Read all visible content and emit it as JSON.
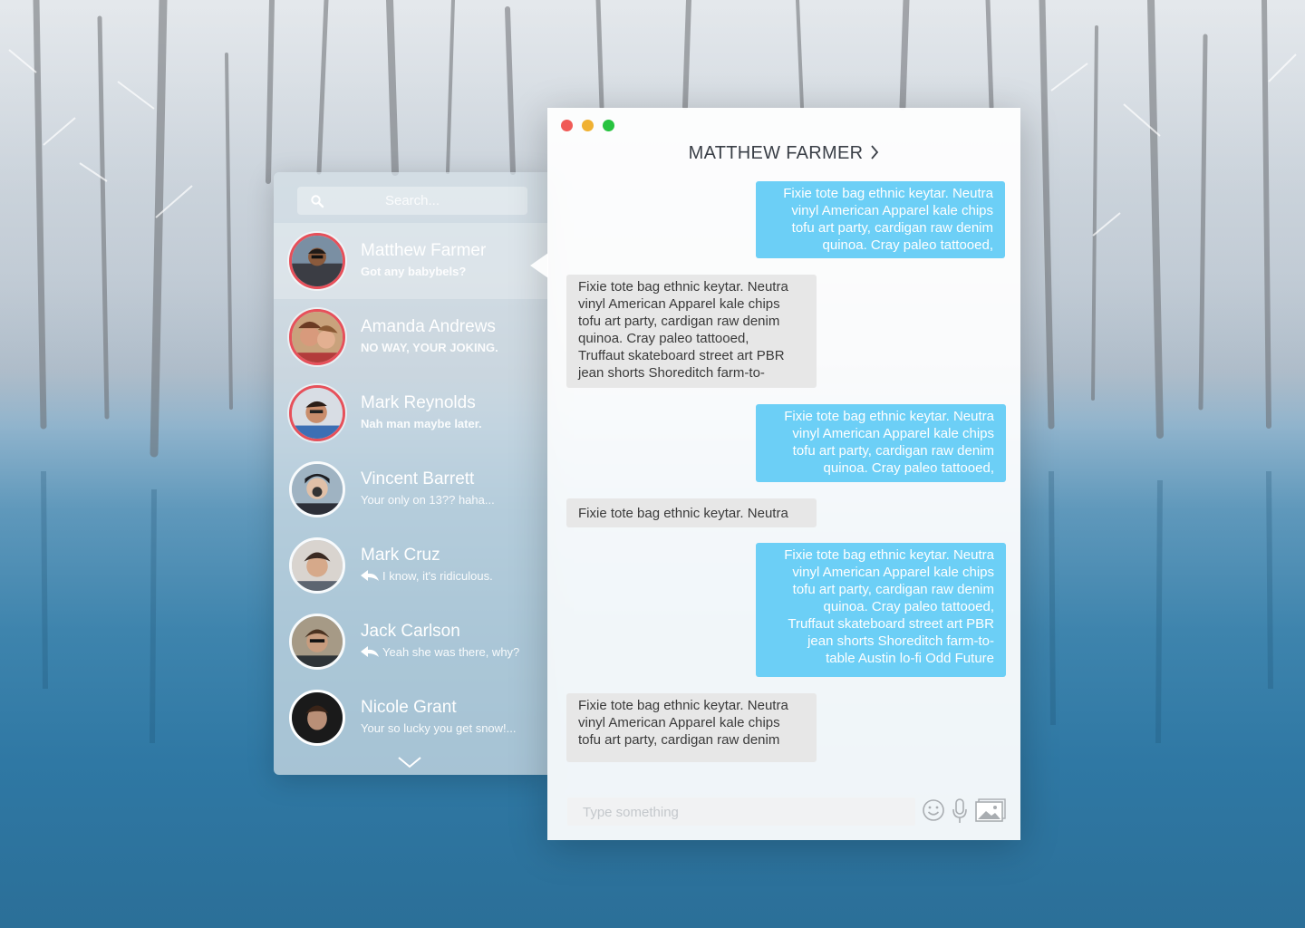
{
  "search": {
    "placeholder": "Search..."
  },
  "conversations": [
    {
      "name": "Matthew Farmer",
      "preview": "Got any babybels?",
      "active": true,
      "unread": true
    },
    {
      "name": "Amanda Andrews",
      "preview": "NO WAY, YOUR JOKING.",
      "unread": true
    },
    {
      "name": "Mark Reynolds",
      "preview": "Nah man maybe later.",
      "unread": true
    },
    {
      "name": "Vincent Barrett",
      "preview": "Your only on 13?? haha..."
    },
    {
      "name": "Mark Cruz",
      "preview": "I know, it's ridiculous.",
      "replied": true
    },
    {
      "name": "Jack Carlson",
      "preview": "Yeah she was there, why?",
      "replied": true
    },
    {
      "name": "Nicole Grant",
      "preview": "Your so lucky you get snow!..."
    }
  ],
  "chat": {
    "contact_name": "MATTHEW FARMER",
    "messages": [
      {
        "direction": "out",
        "text": "Fixie tote bag ethnic keytar. Neutra\nvinyl American Apparel kale chips\ntofu art party, cardigan raw denim\nquinoa. Cray paleo tattooed,"
      },
      {
        "direction": "in",
        "text": "Fixie tote bag ethnic keytar. Neutra\nvinyl American Apparel kale chips\ntofu art party, cardigan raw denim\nquinoa. Cray paleo tattooed,\nTruffaut skateboard street art PBR\njean shorts Shoreditch farm-to-"
      },
      {
        "direction": "out",
        "text": "Fixie tote bag ethnic keytar. Neutra\nvinyl American Apparel kale chips\ntofu art party, cardigan raw denim\nquinoa. Cray paleo tattooed,"
      },
      {
        "direction": "in",
        "text": "Fixie tote bag ethnic keytar. Neutra"
      },
      {
        "direction": "out",
        "text": "Fixie tote bag ethnic keytar. Neutra\nvinyl American Apparel kale chips\ntofu art party, cardigan raw denim\nquinoa. Cray paleo tattooed,\nTruffaut skateboard street art PBR\njean shorts Shoreditch farm-to-\ntable Austin lo-fi Odd Future"
      },
      {
        "direction": "in",
        "text": "Fixie tote bag ethnic keytar. Neutra\nvinyl American Apparel kale chips\ntofu art party, cardigan raw denim"
      }
    ],
    "composer_placeholder": "Type something"
  },
  "icons": {
    "search": "search-icon",
    "reply": "reply-icon",
    "more": "chevron-down-icon",
    "title_chevron": "chevron-right-icon",
    "emoji": "emoji-icon",
    "mic": "microphone-icon",
    "image": "image-icon"
  },
  "colors": {
    "outgoing_bubble": "#6ccff6",
    "incoming_bubble": "#e7e7e7",
    "unread_ring": "#e7505a",
    "close": "#f05b57",
    "minimize": "#f0b132",
    "maximize": "#27c33f"
  }
}
